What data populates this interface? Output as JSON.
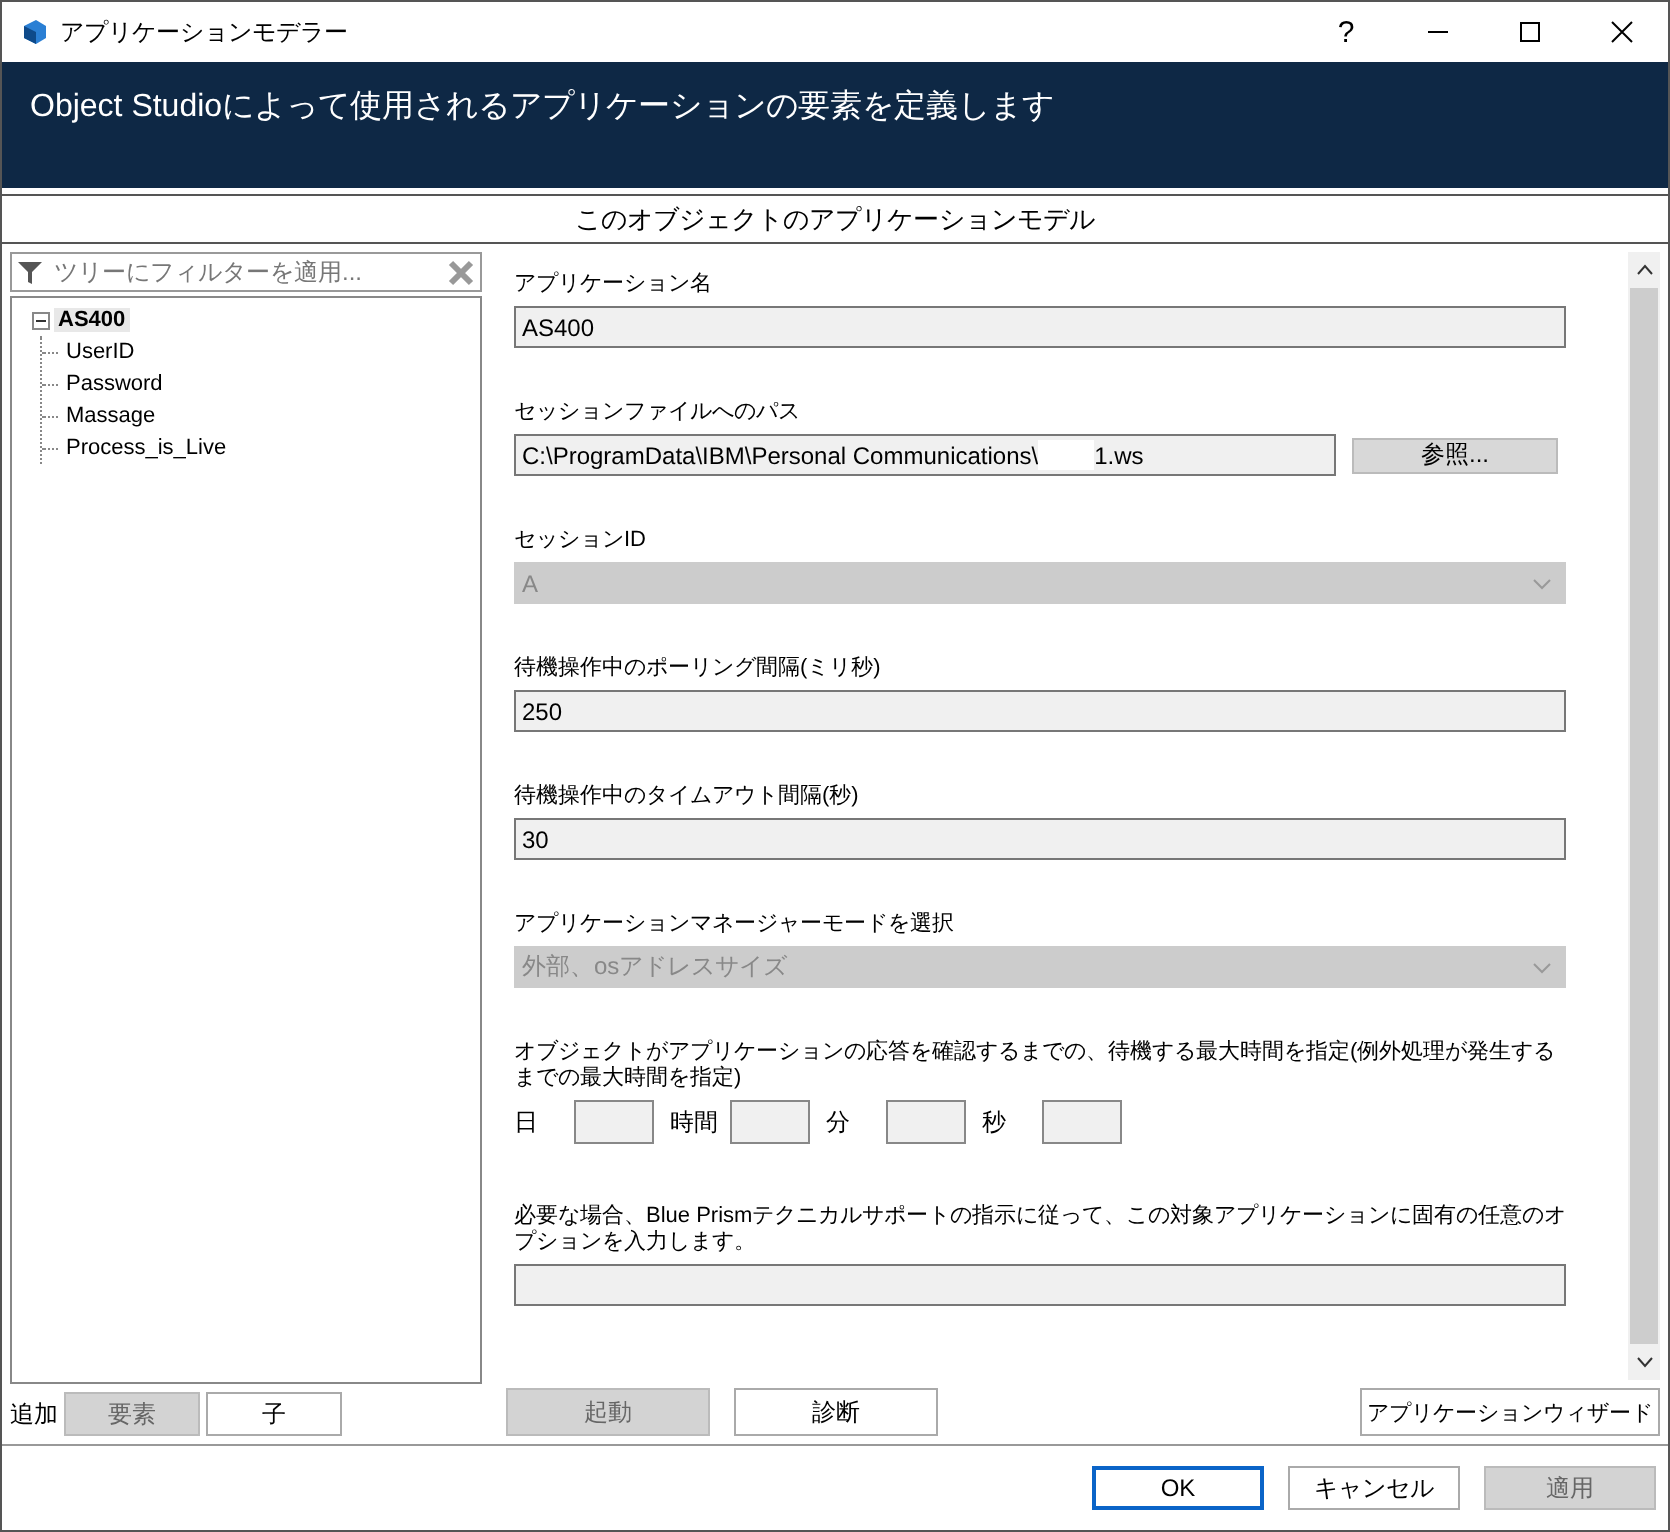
{
  "window": {
    "title": "アプリケーションモデラー",
    "help": "?"
  },
  "header": {
    "text": "Object  Studioによって使用されるアプリケーションの要素を定義します"
  },
  "section_title": "このオブジェクトのアプリケーションモデル",
  "tree_filter": {
    "placeholder": "ツリーにフィルターを適用..."
  },
  "tree": [
    {
      "label": "AS400",
      "selected": true,
      "expanded": true,
      "children": [
        {
          "label": "UserID",
          "selected": false
        },
        {
          "label": "Password",
          "selected": false
        },
        {
          "label": "Massage",
          "selected": false
        },
        {
          "label": "Process_is_Live",
          "selected": false
        }
      ]
    }
  ],
  "add_bar": {
    "label": "追加",
    "buttons": [
      {
        "label": "要素",
        "disabled": true
      },
      {
        "label": "子",
        "disabled": false
      }
    ]
  },
  "fields": [
    {
      "kind": "text",
      "label": "アプリケーション名",
      "value": "AS400"
    },
    {
      "kind": "path",
      "label": "セッションファイルへのパス",
      "value_start": "C:\\ProgramData\\IBM\\Personal Communications\\",
      "value_end": "1.ws",
      "button": "参照..."
    },
    {
      "kind": "dropdown",
      "label": "セッションID",
      "value": "A",
      "disabled": true
    },
    {
      "kind": "text",
      "label": "待機操作中のポーリング間隔(ミリ秒)",
      "value": "250"
    },
    {
      "kind": "text",
      "label": "待機操作中のタイムアウト間隔(秒)",
      "value": "30"
    },
    {
      "kind": "dropdown",
      "label": "アプリケーションマネージャーモードを選択",
      "value": "外部、osアドレスサイズ",
      "disabled": true
    },
    {
      "kind": "duration",
      "label": "オブジェクトがアプリケーションの応答を確認するまでの、待機する最大時間を指定(例外処理が発生するまでの最大時間を指定)",
      "units": [
        "日",
        "時間",
        "分",
        "秒"
      ]
    },
    {
      "kind": "text",
      "label": "必要な場合、Blue Prismテクニカルサポートの指示に従って、この対象アプリケーションに固有の任意のオプションを入力します。"
    }
  ],
  "actions": [
    {
      "label": "起動",
      "disabled": true
    },
    {
      "label": "診断",
      "disabled": false
    }
  ],
  "wizard_button": "アプリケーションウィザード",
  "dialog_buttons": [
    {
      "label": "OK",
      "default": true,
      "disabled": false
    },
    {
      "label": "キャンセル",
      "default": false,
      "disabled": false
    },
    {
      "label": "適用",
      "default": false,
      "disabled": true
    }
  ]
}
